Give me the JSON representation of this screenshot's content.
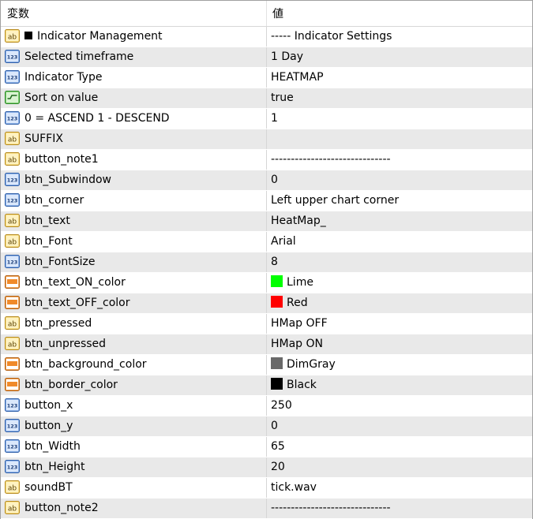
{
  "header": {
    "col_name": "変数",
    "col_value": "値"
  },
  "colors": {
    "Lime": "#00ff00",
    "Red": "#ff0000",
    "DimGray": "#696969",
    "Black": "#000000"
  },
  "rows": [
    {
      "icon": "ab-icon",
      "name": "Indicator Management",
      "value": "----- Indicator Settings",
      "marker": true
    },
    {
      "icon": "123-icon",
      "name": "Selected timeframe",
      "value": "1 Day"
    },
    {
      "icon": "123-icon",
      "name": "Indicator Type",
      "value": "HEATMAP"
    },
    {
      "icon": "bool-icon",
      "name": "Sort on value",
      "value": "true"
    },
    {
      "icon": "123-icon",
      "name": "0 = ASCEND 1 - DESCEND",
      "value": "1"
    },
    {
      "icon": "ab-icon",
      "name": "SUFFIX",
      "value": ""
    },
    {
      "icon": "ab-icon",
      "name": "button_note1",
      "value": "------------------------------"
    },
    {
      "icon": "123-icon",
      "name": "btn_Subwindow",
      "value": "0"
    },
    {
      "icon": "123-icon",
      "name": "btn_corner",
      "value": "Left upper chart corner"
    },
    {
      "icon": "ab-icon",
      "name": "btn_text",
      "value": "HeatMap_"
    },
    {
      "icon": "ab-icon",
      "name": "btn_Font",
      "value": "Arial"
    },
    {
      "icon": "123-icon",
      "name": "btn_FontSize",
      "value": "8"
    },
    {
      "icon": "color-icon",
      "name": "btn_text_ON_color",
      "value": "Lime",
      "swatch": "#00ff00"
    },
    {
      "icon": "color-icon",
      "name": "btn_text_OFF_color",
      "value": "Red",
      "swatch": "#ff0000"
    },
    {
      "icon": "ab-icon",
      "name": "btn_pressed",
      "value": "HMap OFF"
    },
    {
      "icon": "ab-icon",
      "name": "btn_unpressed",
      "value": "HMap ON"
    },
    {
      "icon": "color-icon",
      "name": "btn_background_color",
      "value": "DimGray",
      "swatch": "#696969"
    },
    {
      "icon": "color-icon",
      "name": "btn_border_color",
      "value": "Black",
      "swatch": "#000000"
    },
    {
      "icon": "123-icon",
      "name": "button_x",
      "value": "250"
    },
    {
      "icon": "123-icon",
      "name": "button_y",
      "value": "0"
    },
    {
      "icon": "123-icon",
      "name": "btn_Width",
      "value": "65"
    },
    {
      "icon": "123-icon",
      "name": "btn_Height",
      "value": "20"
    },
    {
      "icon": "ab-icon",
      "name": "soundBT",
      "value": "tick.wav"
    },
    {
      "icon": "ab-icon",
      "name": "button_note2",
      "value": "------------------------------"
    }
  ]
}
